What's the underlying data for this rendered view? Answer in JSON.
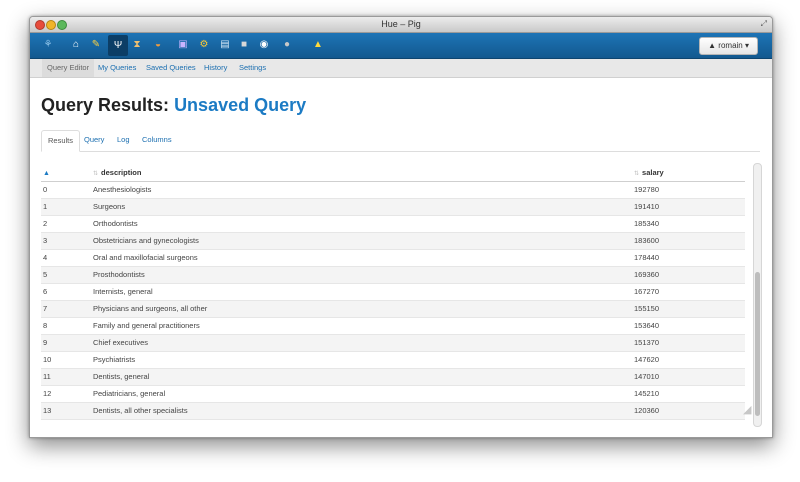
{
  "window": {
    "title": "Hue – Pig"
  },
  "appbar": {
    "icons": [
      {
        "name": "hue-logo-icon",
        "glyph": "⚘",
        "color": "#8fc3e8"
      },
      {
        "name": "home-icon",
        "glyph": "⌂",
        "color": "#ffffff"
      },
      {
        "name": "query-editor-icon",
        "glyph": "✎",
        "color": "#ffd23f"
      },
      {
        "name": "pig-icon",
        "glyph": "Ψ",
        "color": "#ffffff"
      },
      {
        "name": "job-designer-icon",
        "glyph": "⧗",
        "color": "#f0c070"
      },
      {
        "name": "impala-icon",
        "glyph": "◒",
        "color": "#f39c3c"
      },
      {
        "name": "file-browser-icon",
        "glyph": "▣",
        "color": "#c9b4ff"
      },
      {
        "name": "job-browser-icon",
        "glyph": "⚙",
        "color": "#ffcc33"
      },
      {
        "name": "metastore-icon",
        "glyph": "▤",
        "color": "#d7e9f7"
      },
      {
        "name": "shell-icon",
        "glyph": "■",
        "color": "#d8d8d8"
      },
      {
        "name": "oozie-icon",
        "glyph": "◉",
        "color": "#ffffff"
      },
      {
        "name": "security-icon",
        "glyph": "●",
        "color": "#c8c8c8"
      },
      {
        "name": "warning-icon",
        "glyph": "▲",
        "color": "#ffd93b"
      }
    ],
    "user_label": "romain"
  },
  "subnav": [
    "Query Editor",
    "My Queries",
    "Saved Queries",
    "History",
    "Settings"
  ],
  "page": {
    "title_prefix": "Query Results:",
    "title_accent": "Unsaved Query"
  },
  "tabs": [
    "Results",
    "Query",
    "Log",
    "Columns"
  ],
  "table": {
    "columns": [
      "description",
      "salary"
    ],
    "rows": [
      [
        "0",
        "Anesthesiologists",
        "192780"
      ],
      [
        "1",
        "Surgeons",
        "191410"
      ],
      [
        "2",
        "Orthodontists",
        "185340"
      ],
      [
        "3",
        "Obstetricians and gynecologists",
        "183600"
      ],
      [
        "4",
        "Oral and maxillofacial surgeons",
        "178440"
      ],
      [
        "5",
        "Prosthodontists",
        "169360"
      ],
      [
        "6",
        "Internists, general",
        "167270"
      ],
      [
        "7",
        "Physicians and surgeons, all other",
        "155150"
      ],
      [
        "8",
        "Family and general practitioners",
        "153640"
      ],
      [
        "9",
        "Chief executives",
        "151370"
      ],
      [
        "10",
        "Psychiatrists",
        "147620"
      ],
      [
        "11",
        "Dentists, general",
        "147010"
      ],
      [
        "12",
        "Pediatricians, general",
        "145210"
      ],
      [
        "13",
        "Dentists, all other specialists",
        "120360"
      ]
    ]
  },
  "colors": {
    "brand_blue": "#1c7bc4",
    "appbar": "#1d74b6"
  }
}
